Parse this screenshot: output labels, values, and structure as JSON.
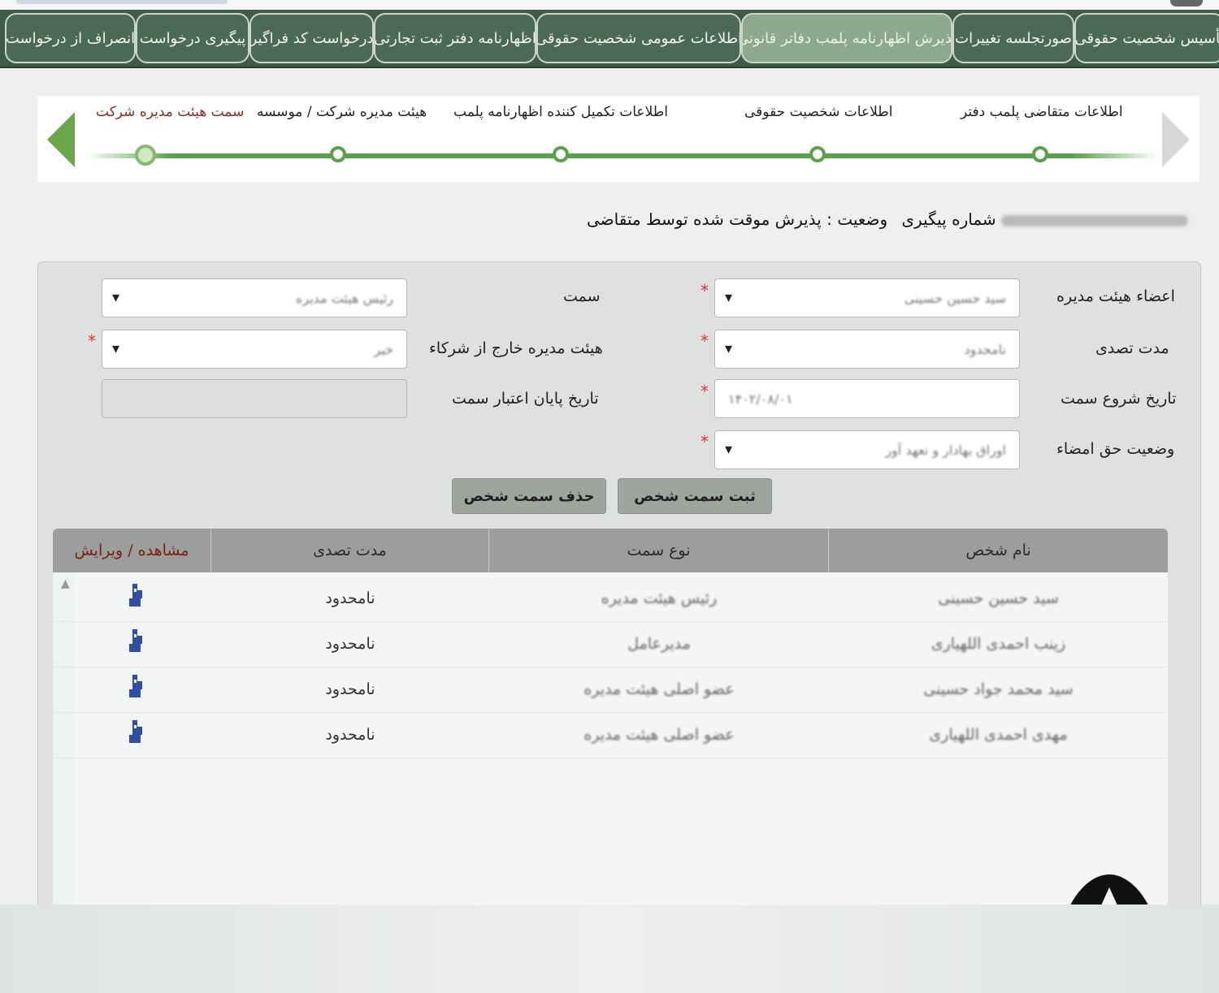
{
  "tabs": [
    {
      "label": "تأسیس شخصیت حقوقی",
      "active": false
    },
    {
      "label": "صورتجلسه تغییرات",
      "active": false
    },
    {
      "label": "پذیرش اظهارنامه پلمب دفاتر قانونی",
      "active": true
    },
    {
      "label": "اطلاعات عمومی شخصیت حقوقی",
      "active": false
    },
    {
      "label": "اظهارنامه دفتر ثبت تجارتی",
      "active": false
    },
    {
      "label": "درخواست کد فراگیر",
      "active": false
    },
    {
      "label": "پیگیری درخواست",
      "active": false
    },
    {
      "label": "انصراف از درخواست",
      "active": false
    }
  ],
  "steps": [
    {
      "label": "اطلاعات متقاضی پلمب دفتر",
      "current": false
    },
    {
      "label": "اطلاعات شخصیت حقوقی",
      "current": false
    },
    {
      "label": "اطلاعات تکمیل کننده اظهارنامه پلمب",
      "current": false
    },
    {
      "label": "هیئت مدیره شرکت / موسسه",
      "current": false
    },
    {
      "label": "سمت هیئت مدیره شرکت",
      "current": true
    }
  ],
  "status": {
    "tracking_label": "شماره پیگیری",
    "state_text": "وضعیت : پذیرش موقت شده توسط متقاضی"
  },
  "form": {
    "members_label": "اعضاء هیئت مدیره",
    "members_value": "سید حسین حسینی",
    "position_label": "سمت",
    "position_value": "رئیس هیئت مدیره",
    "term_label": "مدت تصدی",
    "term_value": "نامحدود",
    "outside_label": "هیئت مدیره خارج از شرکاء",
    "outside_value": "خیر",
    "start_label": "تاریخ شروع سمت",
    "start_value": "۱۴۰۲/۰۸/۰۱",
    "end_label": "تاریخ پایان اعتبار سمت",
    "end_value": "",
    "sign_label": "وضعیت حق امضاء",
    "sign_value": "اوراق بهادار و تعهد آور",
    "chevron": "▾"
  },
  "buttons": {
    "save": "ثبت سمت شخص",
    "delete": "حذف سمت شخص"
  },
  "grid": {
    "headers": {
      "name": "نام شخص",
      "position": "نوع سمت",
      "term": "مدت تصدی",
      "view": "مشاهده / ویرایش"
    },
    "rows": [
      {
        "name": "سید حسین حسینی",
        "position": "رئیس هیئت مدیره",
        "term": "نامحدود"
      },
      {
        "name": "زینب احمدی اللهیاری",
        "position": "مدیرعامل",
        "term": "نامحدود"
      },
      {
        "name": "سید محمد جواد حسینی",
        "position": "عضو اصلی هیئت مدیره",
        "term": "نامحدود"
      },
      {
        "name": "مهدی احمدی اللهیاری",
        "position": "عضو اصلی هیئت مدیره",
        "term": "نامحدود"
      }
    ]
  },
  "colors": {
    "tabbar": "#3f5a49",
    "active_tab": "#8ca98d",
    "step_line": "#5aa24a",
    "required": "#dd3333"
  },
  "icons": {
    "edit": "edit-icon",
    "prev": "arrow-left-icon",
    "next": "arrow-right-icon"
  }
}
